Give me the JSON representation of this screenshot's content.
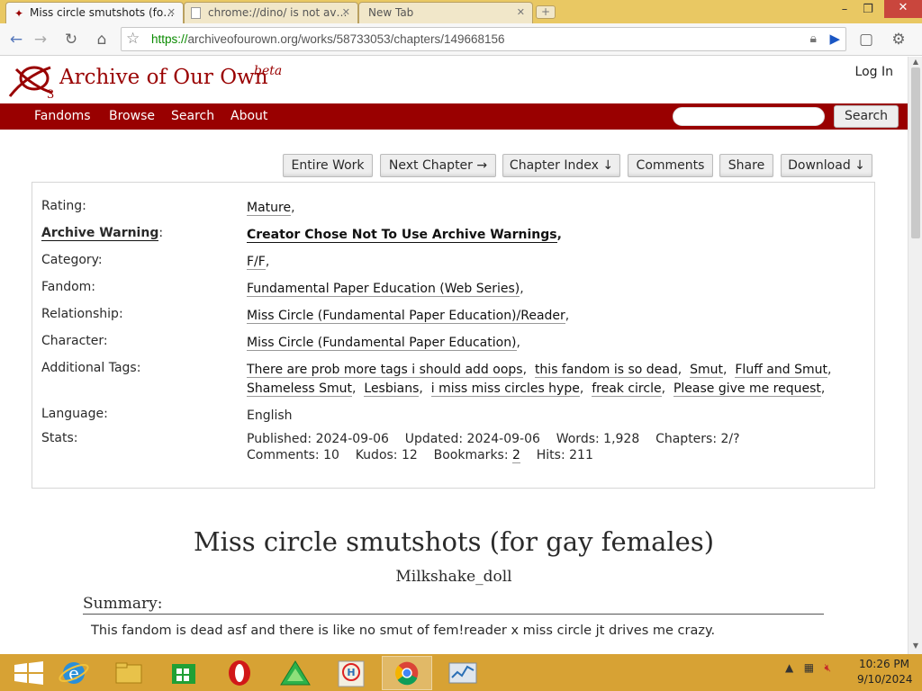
{
  "browser": {
    "tabs": [
      {
        "title": "Miss circle smutshots (fo…",
        "active": true
      },
      {
        "title": "chrome://dino/ is not av…",
        "active": false
      },
      {
        "title": "New Tab",
        "active": false
      }
    ],
    "url_scheme": "https://",
    "url_rest": "archiveofourown.org/works/58733053/chapters/149668156"
  },
  "site": {
    "name": "Archive of Our Own",
    "beta": "beta",
    "login": "Log In",
    "nav": [
      "Fandoms",
      "Browse",
      "Search",
      "About"
    ],
    "search_button": "Search",
    "brand_color": "#990000"
  },
  "work_nav": [
    "Entire Work",
    "Next Chapter →",
    "Chapter Index ↓",
    "Comments",
    "Share",
    "Download ↓"
  ],
  "meta": {
    "rating_label": "Rating:",
    "rating": "Mature",
    "warning_label": "Archive Warning",
    "warning": "Creator Chose Not To Use Archive Warnings",
    "category_label": "Category:",
    "category": "F/F",
    "fandom_label": "Fandom:",
    "fandom": "Fundamental Paper Education (Web Series)",
    "relationship_label": "Relationship:",
    "relationship": "Miss Circle (Fundamental Paper Education)/Reader",
    "character_label": "Character:",
    "character": "Miss Circle (Fundamental Paper Education)",
    "tags_label": "Additional Tags:",
    "tags": [
      "There are prob more tags i should add oops",
      "this fandom is so dead",
      "Smut",
      "Fluff and Smut",
      "Shameless Smut",
      "Lesbians",
      "i miss miss circles hype",
      "freak circle",
      "Please give me request"
    ],
    "language_label": "Language:",
    "language": "English",
    "stats_label": "Stats:",
    "stats": {
      "published_label": "Published:",
      "published": "2024-09-06",
      "updated_label": "Updated:",
      "updated": "2024-09-06",
      "words_label": "Words:",
      "words": "1,928",
      "chapters_label": "Chapters:",
      "chapters": "2/?",
      "comments_label": "Comments:",
      "comments": "10",
      "kudos_label": "Kudos:",
      "kudos": "12",
      "bookmarks_label": "Bookmarks:",
      "bookmarks": "2",
      "hits_label": "Hits:",
      "hits": "211"
    }
  },
  "work": {
    "title": "Miss circle smutshots (for gay females)",
    "author": "Milkshake_doll",
    "summary_heading": "Summary:",
    "summary": "This fandom is dead asf and there is like no smut of fem!reader x miss circle jt drives me crazy."
  },
  "taskbar": {
    "time": "10:26 PM",
    "date": "9/10/2024"
  }
}
